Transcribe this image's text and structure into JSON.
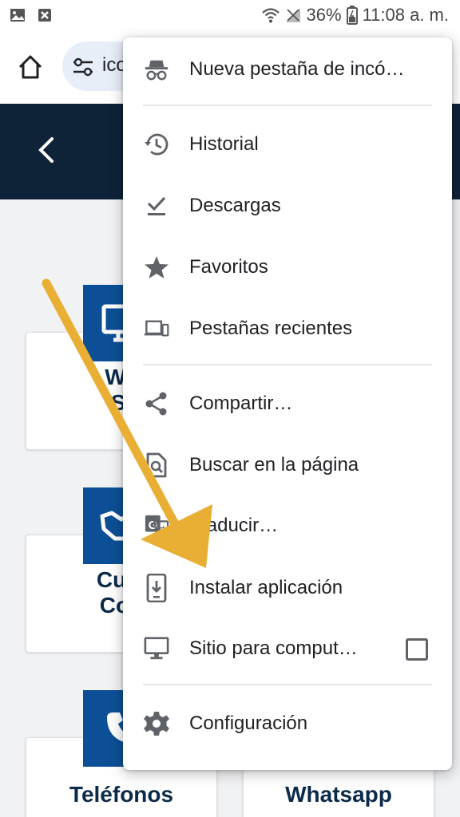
{
  "status_bar": {
    "battery": "36%",
    "time": "11:08 a. m."
  },
  "omnibox": {
    "text": "ico"
  },
  "site_cards": {
    "card1_label": "We\nSi",
    "card2_label": "Cum\nCon",
    "card3_label": "Teléfonos",
    "card4_label": "Whatsapp"
  },
  "menu": {
    "items": [
      {
        "label": "Nueva pestaña de incó…",
        "icon": "incognito-icon"
      },
      {
        "label": "Historial",
        "icon": "history-icon"
      },
      {
        "label": "Descargas",
        "icon": "download-done-icon"
      },
      {
        "label": "Favoritos",
        "icon": "star-icon"
      },
      {
        "label": "Pestañas recientes",
        "icon": "devices-icon"
      },
      {
        "label": "Compartir…",
        "icon": "share-icon"
      },
      {
        "label": "Buscar en la página",
        "icon": "find-in-page-icon"
      },
      {
        "label": "Traducir…",
        "icon": "translate-icon"
      },
      {
        "label": "Instalar aplicación",
        "icon": "install-app-icon"
      },
      {
        "label": "Sitio para comput…",
        "icon": "desktop-icon"
      },
      {
        "label": "Configuración",
        "icon": "settings-icon"
      }
    ],
    "desktop_site_checked": false
  },
  "colors": {
    "header": "#0e2238",
    "card_icon": "#0d4f96",
    "arrow": "#e9ae34"
  }
}
